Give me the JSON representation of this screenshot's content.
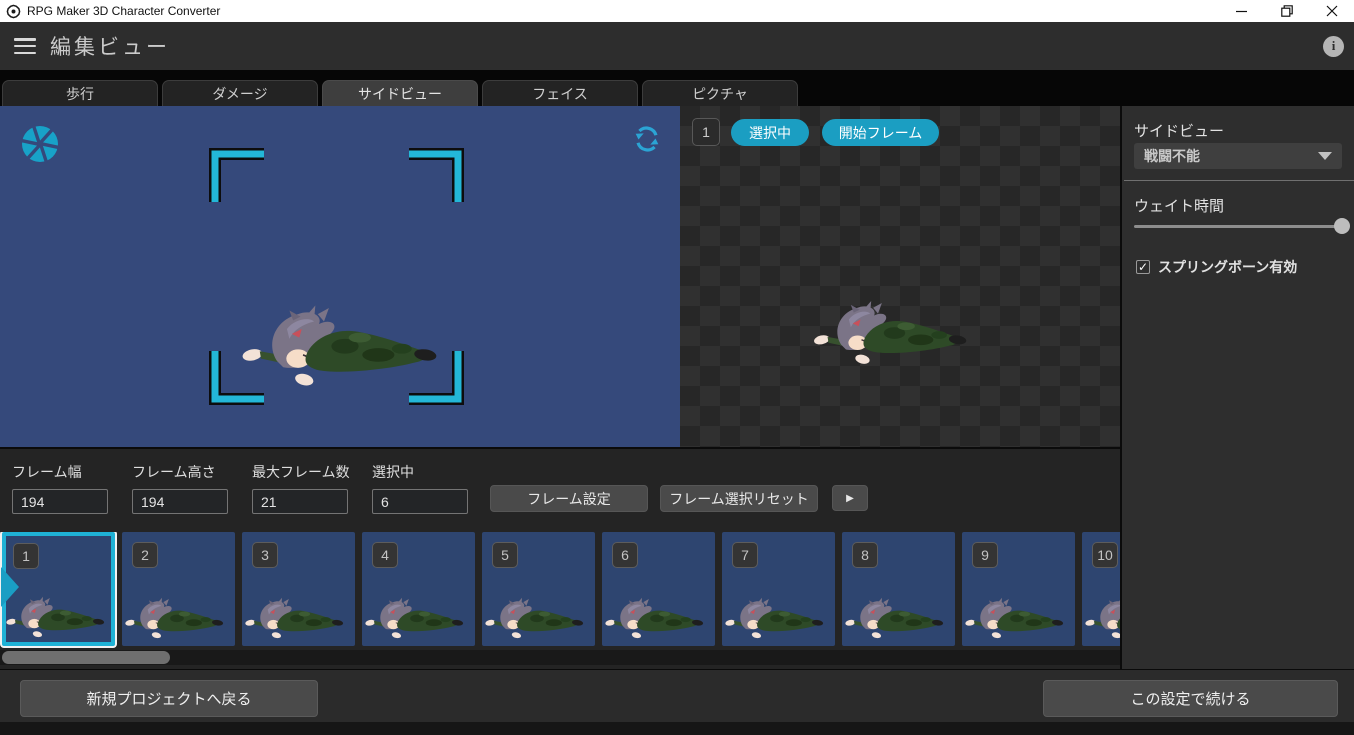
{
  "titlebar": {
    "app_title": "RPG Maker 3D Character Converter"
  },
  "header": {
    "title": "編集ビュー",
    "info_label": "i"
  },
  "tabs": {
    "items": [
      {
        "label": "歩行"
      },
      {
        "label": "ダメージ"
      },
      {
        "label": "サイドビュー"
      },
      {
        "label": "フェイス"
      },
      {
        "label": "ピクチャ"
      }
    ],
    "active_index": 2
  },
  "stage": {
    "frame_badge": "1",
    "selected_label": "選択中",
    "start_frame_label": "開始フレーム"
  },
  "side_panel": {
    "title": "サイドビュー",
    "dropdown_value": "戦闘不能",
    "wait_time_label": "ウェイト時間",
    "wait_slider_percent": 100,
    "spring_bone_label": "スプリングボーン有効",
    "spring_bone_checked": true,
    "checkmark": "✓"
  },
  "frame_controls": {
    "fields": [
      {
        "label": "フレーム幅",
        "value": "194"
      },
      {
        "label": "フレーム高さ",
        "value": "194"
      },
      {
        "label": "最大フレーム数",
        "value": "21"
      },
      {
        "label": "選択中",
        "value": "6"
      }
    ],
    "frame_settings_label": "フレーム設定",
    "frame_reset_label": "フレーム選択リセット",
    "play_label": "▶"
  },
  "frames": {
    "numbers": [
      "1",
      "2",
      "3",
      "4",
      "5",
      "6",
      "7",
      "8",
      "9",
      "10"
    ],
    "selected_index": 0
  },
  "footer": {
    "back_label": "新規プロジェクトへ戻る",
    "continue_label": "この設定で続ける"
  },
  "colors": {
    "accent_teal": "#1b9ec2",
    "selection_cyan": "#1fb2d6",
    "preview_blue": "#35497b",
    "thumbnail_blue": "#2e4570",
    "bracket_cyan": "#23b7d8"
  }
}
